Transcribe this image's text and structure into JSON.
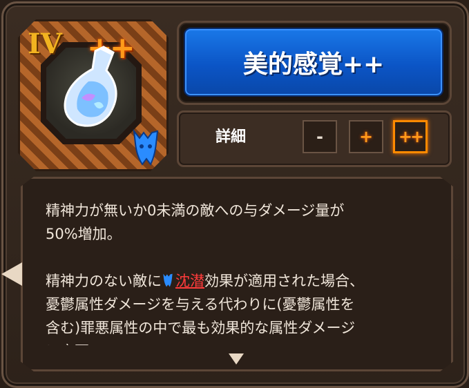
{
  "item": {
    "rank": "IV",
    "tier_mark": "++",
    "title": "美的感覚++",
    "detail_label": "詳細",
    "tiers": [
      "-",
      "+",
      "++"
    ],
    "selected_tier": "++"
  },
  "description": {
    "line1": "精神力が無いか0未満の敵への与ダメージ量が",
    "line2": "50%増加。",
    "line3_pre": "精神力のない敵に",
    "line3_keyword": "沈潜",
    "line3_post": "効果が適用された場合、",
    "line4": "憂鬱属性ダメージを与える代わりに(憂鬱属性を",
    "line5": "含む)罪悪属性の中で最も効果的な属性ダメージ",
    "line6": "に変更"
  },
  "colors": {
    "title_blue": "#0b55c6",
    "tier_orange": "#ff9a1a",
    "keyword_red": "#ff3b3b"
  }
}
